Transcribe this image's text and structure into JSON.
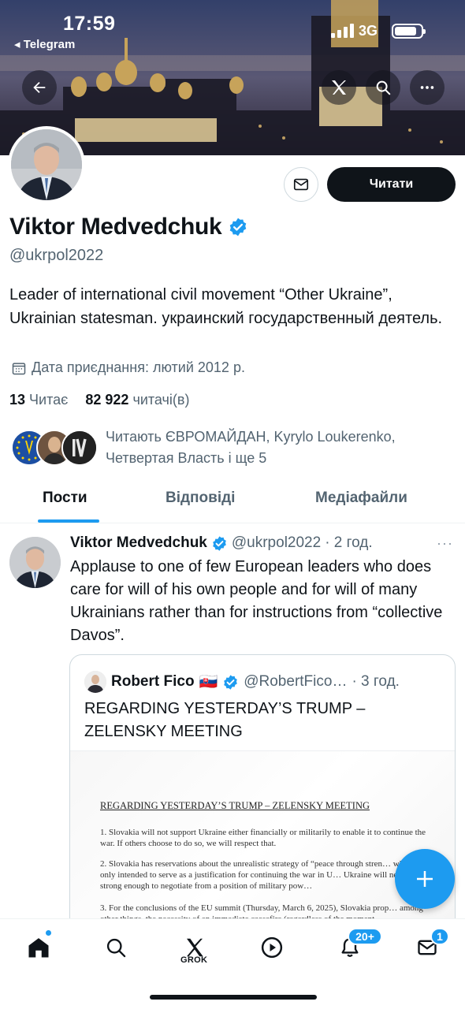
{
  "status_bar": {
    "time": "17:59",
    "back_to_app": "◂ Telegram",
    "network": "3G"
  },
  "header_buttons": {
    "back_icon": "arrow-left-icon",
    "grok_icon": "grok-icon",
    "search_icon": "search-icon",
    "more_icon": "more-dots-icon"
  },
  "profile": {
    "name": "Viktor Medvedchuk",
    "handle": "@ukrpol2022",
    "bio": "Leader of international civil movement “Other Ukraine”, Ukrainian statesman. украинский государственный деятель.",
    "joined": "Дата приєднання: лютий 2012 р.",
    "following_count": "13",
    "following_label": "Читає",
    "followers_count": "82 922",
    "followers_label": "читачі(в)",
    "followed_by": "Читають ЄВРОМАЙДАН, Kyrylo Loukerenko, Четвертая Власть і ще 5",
    "follow_button": "Читати",
    "message_icon": "envelope-icon"
  },
  "tabs": [
    {
      "label": "Пости",
      "active": true
    },
    {
      "label": "Відповіді",
      "active": false
    },
    {
      "label": "Медіафайли",
      "active": false
    }
  ],
  "post": {
    "author": "Viktor Medvedchuk",
    "handle": "@ukrpol2022",
    "time": "· 2 год.",
    "more": "···",
    "text": "Applause to one of few European leaders who does care for will of his own people and for will of many Ukrainians rather than for instructions from “collective Davos”.",
    "quote": {
      "author": "Robert Fico",
      "flag": "🇸🇰",
      "handle": "@RobertFico…",
      "time": "· 3 год.",
      "text": "REGARDING YESTERDAY’S TRUMP – ZELENSKY MEETING",
      "doc_title": "REGARDING YESTERDAY’S TRUMP – ZELENSKY MEETING",
      "doc_p1": "1. Slovakia will not support Ukraine either financially or militarily to enable it to continue the war. If others choose to do so, we will respect that.",
      "doc_p2": "2. Slovakia has reservations about the unrealistic strategy of “peace through stren… which is only intended to serve as a justification for continuing the war in U… Ukraine will never be strong enough to negotiate from a position of military pow…",
      "doc_p3": "3. For the conclusions of the EU summit (Thursday, March 6, 2025), Slovakia prop… among other things, the necessity of an immediate ceasefire (regardless of the moment…"
    }
  },
  "bottom_nav": {
    "items": [
      "home-icon",
      "search-icon",
      "grok-icon",
      "video-icon",
      "bell-icon",
      "mail-icon"
    ],
    "grok_label": "GROK",
    "notifications_badge": "20+",
    "messages_badge": "1"
  },
  "colors": {
    "accent": "#1d9bf0",
    "text": "#0f1419",
    "secondary": "#536471"
  }
}
